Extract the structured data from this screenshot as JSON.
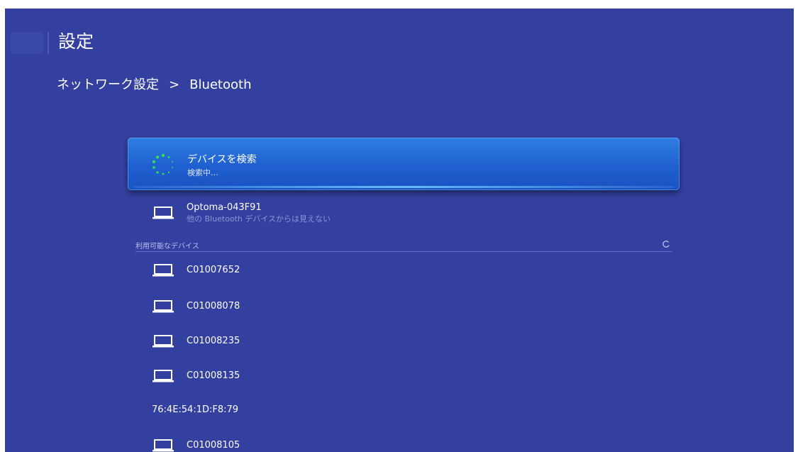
{
  "header": {
    "title": "設定"
  },
  "breadcrumb": {
    "parent": "ネットワーク設定",
    "separator": ">",
    "current": "Bluetooth"
  },
  "search": {
    "title": "デバイスを検索",
    "status": "検索中..."
  },
  "this_device": {
    "name": "Optoma-043F91",
    "visibility": "他の Bluetooth デバイスからは見えない"
  },
  "available": {
    "label": "利用可能なデバイス",
    "devices": [
      {
        "name": "C01007652",
        "icon": "laptop-icon"
      },
      {
        "name": "C01008078",
        "icon": "laptop-icon"
      },
      {
        "name": "C01008235",
        "icon": "laptop-icon"
      },
      {
        "name": "C01008135",
        "icon": "laptop-icon"
      },
      {
        "name": "76:4E:54:1D:F8:79",
        "icon": ""
      },
      {
        "name": "C01008105",
        "icon": "laptop-icon"
      }
    ]
  },
  "colors": {
    "background": "#3340a0",
    "accent": "#1f5fcf",
    "spinner": "#35e34a"
  }
}
